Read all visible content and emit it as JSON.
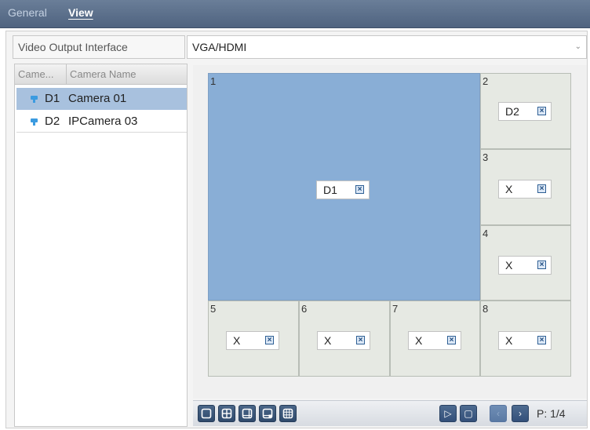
{
  "tabs": {
    "general": "General",
    "view": "View"
  },
  "output": {
    "label": "Video Output Interface",
    "value": "VGA/HDMI"
  },
  "camera_list": {
    "headers": {
      "camera_no": "Came...",
      "camera_name": "Camera Name"
    },
    "rows": [
      {
        "no": "D1",
        "name": "Camera 01",
        "selected": true
      },
      {
        "no": "D2",
        "name": "IPCamera 03",
        "selected": false
      }
    ]
  },
  "windows": [
    {
      "number": "1",
      "channel": "D1"
    },
    {
      "number": "2",
      "channel": "D2"
    },
    {
      "number": "3",
      "channel": "X"
    },
    {
      "number": "4",
      "channel": "X"
    },
    {
      "number": "5",
      "channel": "X"
    },
    {
      "number": "6",
      "channel": "X"
    },
    {
      "number": "7",
      "channel": "X"
    },
    {
      "number": "8",
      "channel": "X"
    }
  ],
  "toolbar": {
    "layout_icons": [
      "single-layout-icon",
      "quad-layout-icon",
      "one-plus-five-layout-icon",
      "one-plus-seven-layout-icon",
      "nine-layout-icon"
    ],
    "pager": "P: 1/4"
  },
  "colors": {
    "selected_window": "#89aed6",
    "selected_row": "#a8c1de",
    "tabbar": "#5a6e8a"
  }
}
